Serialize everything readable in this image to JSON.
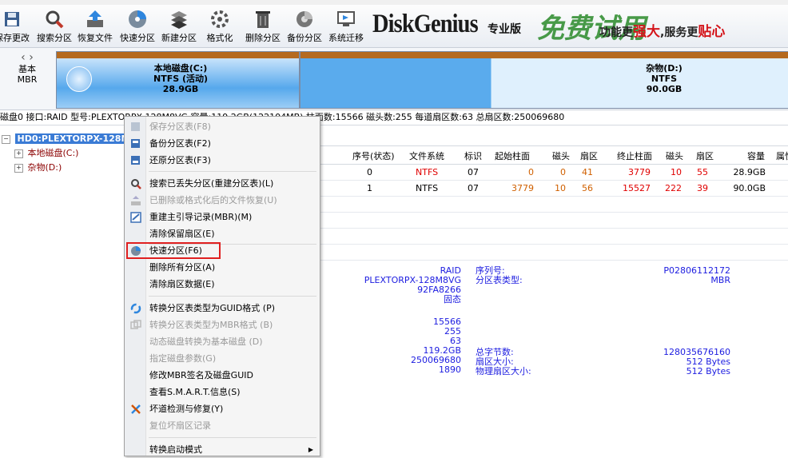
{
  "toolbar": {
    "items": [
      {
        "label": "保存更改",
        "icon": "save-icon"
      },
      {
        "label": "搜索分区",
        "icon": "search-partition-icon"
      },
      {
        "label": "恢复文件",
        "icon": "recover-files-icon"
      },
      {
        "label": "快速分区",
        "icon": "quick-partition-icon"
      },
      {
        "label": "新建分区",
        "icon": "new-partition-icon"
      },
      {
        "label": "格式化",
        "icon": "format-icon"
      },
      {
        "label": "删除分区",
        "icon": "delete-partition-icon"
      },
      {
        "label": "备份分区",
        "icon": "backup-partition-icon"
      },
      {
        "label": "系统迁移",
        "icon": "system-migration-icon"
      }
    ]
  },
  "banner": {
    "title": "DiskGenius",
    "edition": "专业版",
    "free": "免费试用",
    "slogan_prefix": "功能更",
    "slogan_em1": "强大",
    "slogan_mid": ",服务更",
    "slogan_em2": "贴心"
  },
  "disk": {
    "nav_arrows": "‹ ›",
    "type_line1": "基本",
    "type_line2": "MBR",
    "partitions": [
      {
        "name": "本地磁盘(C:)",
        "fs": "NTFS (活动)",
        "size": "28.9GB"
      },
      {
        "name": "杂物(D:)",
        "fs": "NTFS",
        "size": "90.0GB"
      }
    ],
    "info_line": "磁盘0 接口:RAID  型号:PLEXTORPX-128M8VG  容量:119.2GB(122104MB)  柱面数:15566  磁头数:255  每道扇区数:63  总扇区数:250069680"
  },
  "tree": {
    "root_label": "HD0:PLEXTORPX-128M8VG",
    "children": [
      "本地磁盘(C:)",
      "杂物(D:)"
    ]
  },
  "partition_table": {
    "headers": [
      "序号(状态)",
      "文件系统",
      "标识",
      "起始柱面",
      "磁头",
      "扇区",
      "终止柱面",
      "磁头",
      "扇区",
      "容量",
      "属性"
    ],
    "rows": [
      {
        "index": "0",
        "fs": "NTFS",
        "id": "07",
        "start_cyl": "0",
        "start_head": "0",
        "start_sec": "41",
        "end_cyl": "3779",
        "end_head": "10",
        "end_sec": "55",
        "size": "28.9GB"
      },
      {
        "index": "1",
        "fs": "NTFS",
        "id": "07",
        "start_cyl": "3779",
        "start_head": "10",
        "start_sec": "56",
        "end_cyl": "15527",
        "end_head": "222",
        "end_sec": "39",
        "size": "90.0GB"
      }
    ]
  },
  "details": {
    "left_values": [
      "RAID",
      "PLEXTORPX-128M8VG",
      "92FA8266",
      "固态"
    ],
    "mid_labels_1": [
      "序列号:",
      "分区表类型:"
    ],
    "right_values_1": [
      "P02806112172",
      "MBR"
    ],
    "left_values_2": [
      "15566",
      "255",
      "63",
      "119.2GB",
      "250069680",
      "1890"
    ],
    "mid_labels_2": [
      "总字节数:",
      "扇区大小:",
      "物理扇区大小:"
    ],
    "right_values_2": [
      "128035676160",
      "512 Bytes",
      "512 Bytes"
    ]
  },
  "context_menu": {
    "items": [
      {
        "label": "保存分区表(F8)",
        "disabled": true,
        "icon": "save-table-icon"
      },
      {
        "label": "备份分区表(F2)",
        "disabled": false,
        "icon": "backup-table-icon"
      },
      {
        "label": "还原分区表(F3)",
        "disabled": false,
        "icon": "restore-table-icon"
      },
      {
        "label": "搜索已丢失分区(重建分区表)(L)",
        "disabled": false,
        "icon": "search-icon"
      },
      {
        "label": "已删除或格式化后的文件恢复(U)",
        "disabled": true,
        "icon": "recover-icon"
      },
      {
        "label": "重建主引导记录(MBR)(M)",
        "disabled": false,
        "icon": "mbr-icon"
      },
      {
        "label": "清除保留扇区(E)",
        "disabled": false,
        "icon": ""
      },
      {
        "label": "快速分区(F6)",
        "disabled": false,
        "icon": "quick-partition-icon"
      },
      {
        "label": "删除所有分区(A)",
        "disabled": false,
        "icon": ""
      },
      {
        "label": "清除扇区数据(E)",
        "disabled": false,
        "icon": ""
      },
      {
        "label": "转换分区表类型为GUID格式 (P)",
        "disabled": false,
        "icon": "convert-guid-icon"
      },
      {
        "label": "转换分区表类型为MBR格式 (B)",
        "disabled": true,
        "icon": "convert-mbr-icon"
      },
      {
        "label": "动态磁盘转换为基本磁盘 (D)",
        "disabled": true,
        "icon": ""
      },
      {
        "label": "指定磁盘参数(G)",
        "disabled": true,
        "icon": ""
      },
      {
        "label": "修改MBR签名及磁盘GUID",
        "disabled": false,
        "icon": ""
      },
      {
        "label": "查看S.M.A.R.T.信息(S)",
        "disabled": false,
        "icon": ""
      },
      {
        "label": "坏道检测与修复(Y)",
        "disabled": false,
        "icon": "tools-icon"
      },
      {
        "label": "复位坏扇区记录",
        "disabled": true,
        "icon": ""
      },
      {
        "label": "转换启动模式",
        "disabled": false,
        "icon": "",
        "submenu": true
      }
    ]
  },
  "colors": {
    "highlight_border": "#e02020",
    "tree_selected": "#3a7bd5",
    "partition_bar": "#b56a1f"
  }
}
